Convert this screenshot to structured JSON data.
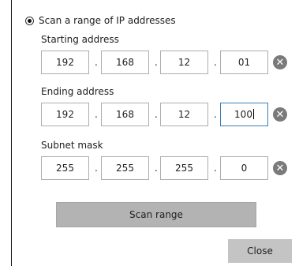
{
  "scan_option": {
    "label": "Scan a range of IP addresses",
    "selected": true
  },
  "starting_address": {
    "label": "Starting address",
    "octets": [
      "192",
      "168",
      "12",
      "01"
    ]
  },
  "ending_address": {
    "label": "Ending address",
    "octets": [
      "192",
      "168",
      "12",
      "100"
    ]
  },
  "subnet_mask": {
    "label": "Subnet mask",
    "octets": [
      "255",
      "255",
      "255",
      "0"
    ]
  },
  "separator": ".",
  "clear_symbol": "✕",
  "buttons": {
    "scan_range": "Scan range",
    "close": "Close"
  }
}
